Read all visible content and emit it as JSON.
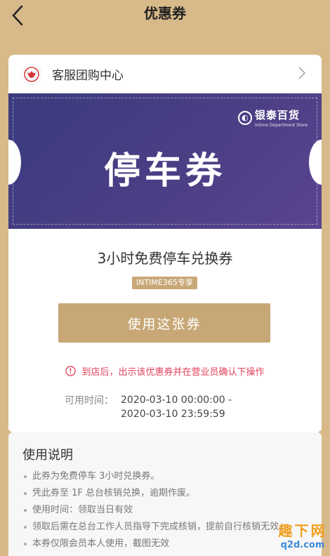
{
  "nav": {
    "title": "优惠券"
  },
  "shop": {
    "name": "客服团购中心"
  },
  "banner": {
    "brand_cn": "银泰百货",
    "brand_en": "Intime Department Store",
    "big_text": "停车券"
  },
  "coupon": {
    "name": "3小时免费停车兑换券",
    "tag": "INTIME365专享",
    "use_button": "使用这张券",
    "notice": "到店后，出示该优惠券并在营业员确认下操作",
    "valid_label": "可用时间：",
    "valid_from": "2020-03-10 00:00:00 -",
    "valid_to": "2020-03-10 23:59:59"
  },
  "instructions": {
    "heading": "使用说明",
    "items": [
      "此券为免费停车 3小时兑换券。",
      "凭此券至 1F 总台核销兑换，逾期作废。",
      "使用时间：领取当日有效",
      "领取后需在总台工作人员指导下完成核销，提前自行核销无效。",
      "本券仅限会员本人使用，截图无效"
    ]
  },
  "watermark": {
    "cn": "趣下网",
    "en": "q2d.com"
  },
  "colors": {
    "page_bg": "#d8b98a",
    "banner": "#3f3c80",
    "button": "#c7a775",
    "notice": "#e0425a"
  },
  "icons": {
    "back": "chevron-left-icon",
    "shop_logo": "intime-logo-icon",
    "shop_chevron": "chevron-right-icon",
    "notice": "exclamation-circle-icon"
  }
}
